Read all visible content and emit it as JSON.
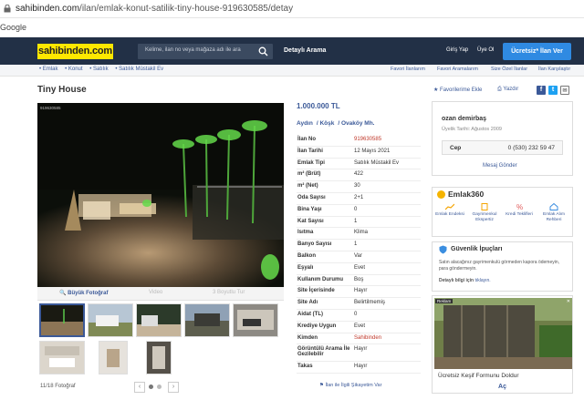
{
  "browser": {
    "url_host": "sahibinden.com",
    "url_path": "/ilan/emlak-konut-satilik-tiny-house-919630585/detay",
    "bookmark": "Google"
  },
  "nav": {
    "logo": "sahibinden.com",
    "search_placeholder": "Kelime, ilan no veya mağaza adı ile ara",
    "detayli": "Detaylı Arama",
    "giris": "Giriş Yap",
    "uye": "Üye Ol",
    "ilan_ver": "Ücretsiz* İlan Ver"
  },
  "breadcrumb": {
    "items": [
      "• Emlak",
      "• Konut",
      "• Satılık",
      "• Satılık Müstakil Ev"
    ],
    "links": [
      "Favori İlanlarım",
      "Favori Aramalarım",
      "Size Özel İlanlar",
      "İlan Karşılaştır"
    ]
  },
  "listing": {
    "title": "Tiny House",
    "favorilerime_ekle": "Favorilerime Ekle",
    "yazdir": "Yazdır",
    "photo_no": "919630585",
    "buyuk_foto": "Büyük Fotoğraf",
    "video": "Video",
    "boyut": "3 Boyutlu Tur",
    "photo_count": "11/18 Fotoğraf",
    "price": "1.000.000 TL",
    "location": [
      "Aydın",
      "Köşk",
      "Ovaköy Mh."
    ],
    "details": [
      {
        "k": "İlan No",
        "v": "919630585",
        "red": true
      },
      {
        "k": "İlan Tarihi",
        "v": "12 Mayıs 2021"
      },
      {
        "k": "Emlak Tipi",
        "v": "Satılık Müstakil Ev"
      },
      {
        "k": "m² (Brüt)",
        "v": "422"
      },
      {
        "k": "m² (Net)",
        "v": "30"
      },
      {
        "k": "Oda Sayısı",
        "v": "2+1"
      },
      {
        "k": "Bina Yaşı",
        "v": "0"
      },
      {
        "k": "Kat Sayısı",
        "v": "1"
      },
      {
        "k": "Isıtma",
        "v": "Klima"
      },
      {
        "k": "Banyo Sayısı",
        "v": "1"
      },
      {
        "k": "Balkon",
        "v": "Var"
      },
      {
        "k": "Eşyalı",
        "v": "Evet"
      },
      {
        "k": "Kullanım Durumu",
        "v": "Boş"
      },
      {
        "k": "Site İçerisinde",
        "v": "Hayır"
      },
      {
        "k": "Site Adı",
        "v": "Belirtilmemiş"
      },
      {
        "k": "Aidat (TL)",
        "v": "0"
      },
      {
        "k": "Krediye Uygun",
        "v": "Evet"
      },
      {
        "k": "Kimden",
        "v": "Sahibinden",
        "red": true
      },
      {
        "k": "Görüntülü Arama İle Gezilebilir",
        "v": "Hayır"
      },
      {
        "k": "Takas",
        "v": "Hayır"
      }
    ],
    "sikayet": "İlan ile İlgili Şikayetim Var"
  },
  "seller": {
    "name": "ozan demirbaş",
    "since": "Üyelik Tarihi: Ağustos 2009",
    "phone_label": "Cep",
    "phone": "0 (530) 232 59 47",
    "mesaj": "Mesaj Gönder"
  },
  "emlak360": {
    "title": "Emlak360",
    "items": [
      "Emlak Endeksi",
      "Gayrimenkul Ekspertiz",
      "Kredi Teklifleri",
      "Emlak Alım Rehberi"
    ]
  },
  "guvenlik": {
    "title": "Güvenlik İpuçları",
    "text": "Satın alacağınız gayrimenkulü görmeden kapora ödemeyin, para göndermeyin.",
    "detay": "Detaylı bilgi için",
    "tikla": "tıklayın."
  },
  "ad": {
    "tag": "Reklam",
    "caption": "Ücretsiz Keşif Formunu Doldur",
    "action": "Aç"
  }
}
